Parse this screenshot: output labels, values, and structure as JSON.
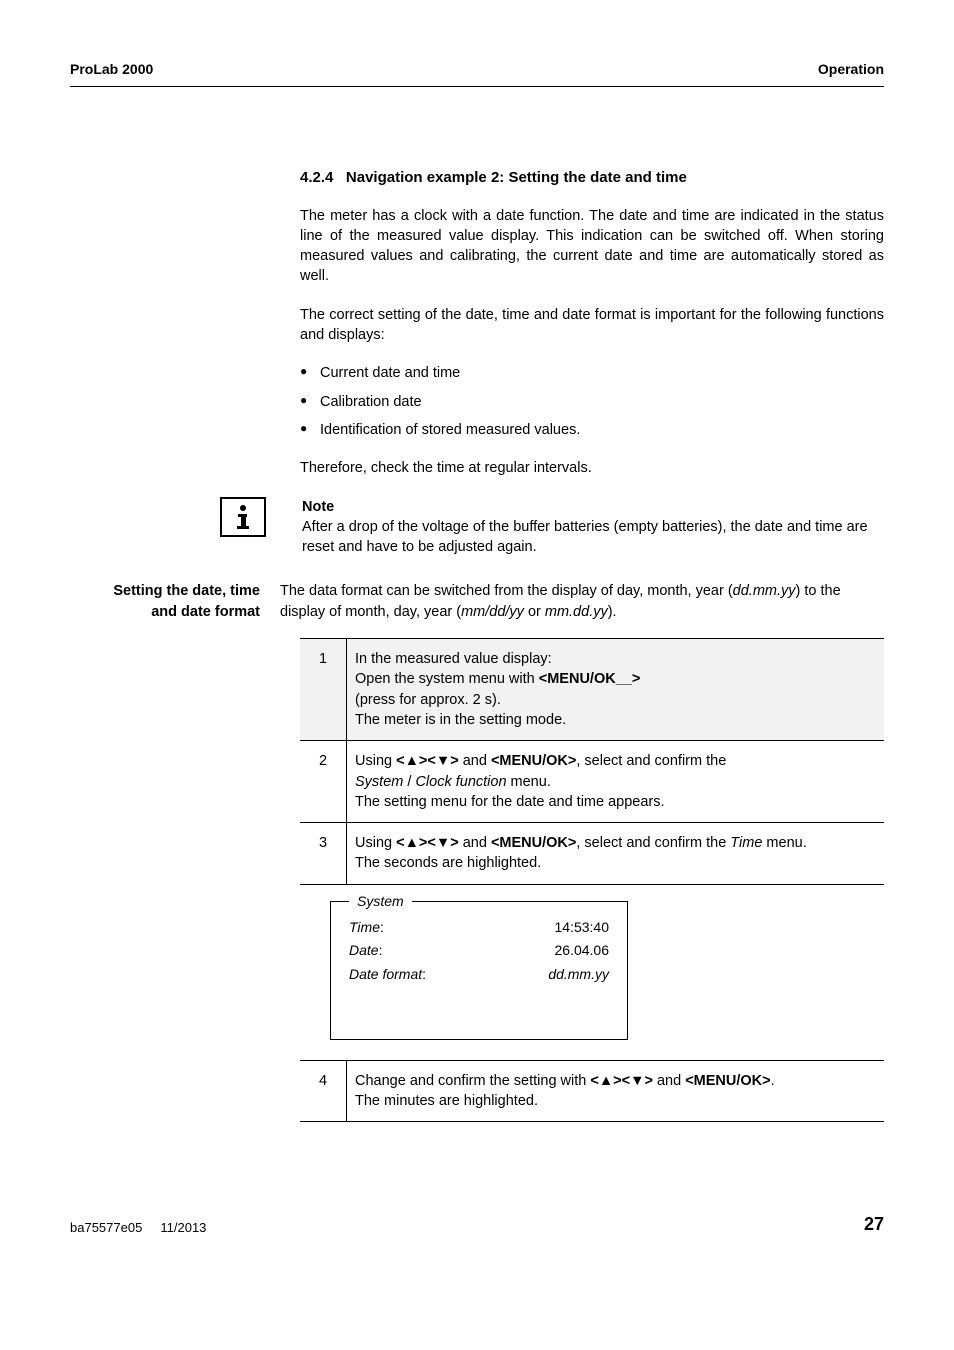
{
  "header": {
    "left": "ProLab 2000",
    "right": "Operation"
  },
  "section": {
    "number": "4.2.4",
    "title": "Navigation example 2: Setting the date and time"
  },
  "para1": "The meter has a clock with a date function. The date and time are indicated in the status line of the measured value display. This indication can be switched off. When storing measured values and calibrating, the current date and time are automatically stored as well.",
  "para2": "The correct setting of the date, time and date format is important for the following functions and displays:",
  "bullets": [
    "Current date and time",
    "Calibration date",
    "Identification of stored measured values."
  ],
  "para3": "Therefore, check the time at regular intervals.",
  "note": {
    "label": "Note",
    "text": "After a drop of the voltage of the buffer batteries (empty batteries), the date and time are reset and have to be adjusted again."
  },
  "sideLabel": {
    "line1": "Setting the date, time",
    "line2": "and date format"
  },
  "sideText_a": "The data format can be switched from the display of day, month, year (",
  "sideText_b": "dd.mm.yy",
  "sideText_c": ") to the display of month, day, year (",
  "sideText_d": "mm/dd/yy",
  "sideText_e": " or ",
  "sideText_f": "mm.dd.yy",
  "sideText_g": ").",
  "steps": [
    {
      "n": "1",
      "a": "In the measured value display:",
      "b1": "Open the system menu with ",
      "b2": "<MENU/OK__>",
      "c": "(press for approx. 2 s).",
      "d": "The meter is in the setting mode."
    },
    {
      "n": "2",
      "a1": "Using ",
      "a2": "<▲><▼>",
      "a3": " and ",
      "a4": "<MENU/OK>",
      "a5": ", select and confirm the ",
      "b1": "System",
      "b2": " / ",
      "b3": "Clock function",
      "b4": " menu.",
      "c": "The setting menu for the date and time appears."
    },
    {
      "n": "3",
      "a1": "Using ",
      "a2": "<▲><▼>",
      "a3": " and ",
      "a4": "<MENU/OK>",
      "a5": ", select and confirm the ",
      "a6": "Time",
      "a7": " menu.",
      "b": "The seconds are highlighted."
    }
  ],
  "systemBox": {
    "legend": "System",
    "rows": [
      {
        "label": "Time",
        "sep": ":",
        "value": "14:53:40"
      },
      {
        "label": "Date",
        "sep": ":",
        "value": "26.04.06"
      },
      {
        "label": "Date format",
        "sep": ":",
        "value": "dd.mm.yy"
      }
    ]
  },
  "step4": {
    "n": "4",
    "a1": "Change and confirm the setting with ",
    "a2": "<▲><▼>",
    "a3": " and ",
    "a4": "<MENU/OK>",
    "a5": ".",
    "b": "The minutes are highlighted."
  },
  "footer": {
    "left1": "ba75577e05",
    "left2": "11/2013",
    "page": "27"
  }
}
